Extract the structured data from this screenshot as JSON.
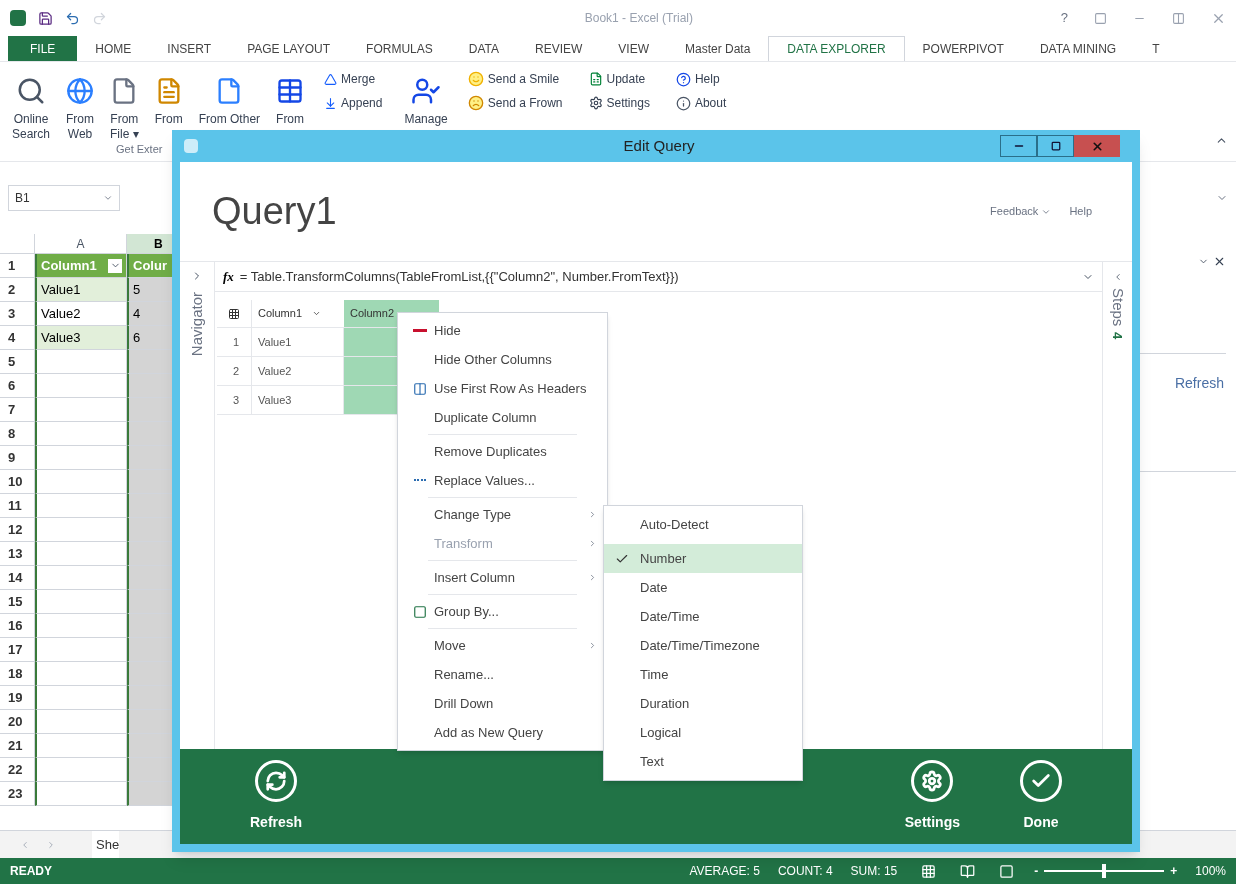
{
  "excel": {
    "title": "Book1 - Excel (Trial)",
    "help": "?",
    "tabs": [
      {
        "label": "FILE",
        "kind": "file",
        "selected": false
      },
      {
        "label": "HOME",
        "kind": "tab",
        "selected": false
      },
      {
        "label": "INSERT",
        "kind": "tab",
        "selected": false
      },
      {
        "label": "PAGE LAYOUT",
        "kind": "tab",
        "selected": false
      },
      {
        "label": "FORMULAS",
        "kind": "tab",
        "selected": false
      },
      {
        "label": "DATA",
        "kind": "tab",
        "selected": false
      },
      {
        "label": "REVIEW",
        "kind": "tab",
        "selected": false
      },
      {
        "label": "VIEW",
        "kind": "tab",
        "selected": false
      },
      {
        "label": "Master Data",
        "kind": "tab",
        "selected": false
      },
      {
        "label": "DATA EXPLORER",
        "kind": "tab",
        "selected": true
      },
      {
        "label": "POWERPIVOT",
        "kind": "tab",
        "selected": false
      },
      {
        "label": "DATA MINING",
        "kind": "tab",
        "selected": false
      },
      {
        "label": "T",
        "kind": "tab",
        "selected": false
      }
    ],
    "ribbon": [
      {
        "kind": "large",
        "lines": [
          "Online",
          "Search"
        ]
      },
      {
        "kind": "large",
        "lines": [
          "From",
          "Web"
        ]
      },
      {
        "kind": "large",
        "lines": [
          "From",
          "File ▾"
        ]
      },
      {
        "kind": "large",
        "lines": [
          "From"
        ]
      },
      {
        "kind": "large",
        "lines": [
          "From Other"
        ]
      },
      {
        "kind": "large",
        "lines": [
          "From"
        ]
      },
      {
        "kind": "stack",
        "lines": [
          "Merge",
          "Append"
        ]
      },
      {
        "kind": "large",
        "lines": [
          "Manage"
        ]
      },
      {
        "kind": "stack",
        "lines": [
          "Send a Smile",
          "Send a Frown"
        ]
      },
      {
        "kind": "stack",
        "lines": [
          "Update",
          "Settings"
        ]
      },
      {
        "kind": "stack",
        "lines": [
          "Help",
          "About"
        ]
      }
    ],
    "group_label": "Get Exter",
    "name_box": "B1",
    "columns": [
      {
        "label": "A",
        "selected": false
      },
      {
        "label": "B",
        "selected": true
      }
    ],
    "rows": [
      {
        "number": "1",
        "kind": "header",
        "cells": [
          "Column1",
          "Colur"
        ]
      },
      {
        "number": "2",
        "kind": "band",
        "cells": [
          "Value1",
          "5"
        ]
      },
      {
        "number": "3",
        "kind": "plain",
        "cells": [
          "Value2",
          "4"
        ]
      },
      {
        "number": "4",
        "kind": "band",
        "cells": [
          "Value3",
          "6"
        ]
      },
      {
        "number": "5",
        "kind": "empty"
      },
      {
        "number": "6",
        "kind": "empty"
      },
      {
        "number": "7",
        "kind": "empty"
      },
      {
        "number": "8",
        "kind": "empty"
      },
      {
        "number": "9",
        "kind": "empty"
      },
      {
        "number": "10",
        "kind": "empty"
      },
      {
        "number": "11",
        "kind": "empty"
      },
      {
        "number": "12",
        "kind": "empty"
      },
      {
        "number": "13",
        "kind": "empty"
      },
      {
        "number": "14",
        "kind": "empty"
      },
      {
        "number": "15",
        "kind": "empty"
      },
      {
        "number": "16",
        "kind": "empty"
      },
      {
        "number": "17",
        "kind": "empty"
      },
      {
        "number": "18",
        "kind": "empty"
      },
      {
        "number": "19",
        "kind": "empty"
      },
      {
        "number": "20",
        "kind": "empty"
      },
      {
        "number": "21",
        "kind": "empty"
      },
      {
        "number": "22",
        "kind": "empty"
      },
      {
        "number": "23",
        "kind": "empty"
      }
    ],
    "sheet_tab": "She",
    "side_pane": {
      "link": "Refresh"
    },
    "status": {
      "ready": "READY",
      "stats": [
        "AVERAGE: 5",
        "COUNT: 4",
        "SUM: 15"
      ],
      "zoom_out": "-",
      "zoom_in": "+",
      "zoom": "100%",
      "level": 0.5
    }
  },
  "dialog": {
    "title": "Edit Query",
    "query_name": "Query1",
    "header_links": [
      {
        "label": "Feedback",
        "dropdown": true
      },
      {
        "label": "Help",
        "dropdown": false
      }
    ],
    "navigator": "Navigator",
    "fx_label": "fx",
    "formula": "= Table.TransformColumns(TableFromList,{{\"Column2\", Number.FromText}})",
    "steps": {
      "label": "Steps",
      "count": "4"
    },
    "table": {
      "columns": [
        {
          "label": "Column1",
          "selected": false
        },
        {
          "label": "Column2",
          "selected": true
        }
      ],
      "rows": [
        {
          "number": "1",
          "cells": [
            "Value1"
          ]
        },
        {
          "number": "2",
          "cells": [
            "Value2"
          ]
        },
        {
          "number": "3",
          "cells": [
            "Value3"
          ]
        }
      ]
    },
    "buttons": [
      {
        "label": "Refresh"
      },
      {
        "label": "Settings"
      },
      {
        "label": "Done"
      }
    ],
    "context_menu": [
      [
        {
          "label": "Hide",
          "disabled": false,
          "submenu": false
        },
        {
          "label": "Hide Other Columns",
          "disabled": false,
          "submenu": false
        },
        {
          "label": "Use First Row As Headers",
          "disabled": false,
          "submenu": false
        },
        {
          "label": "Duplicate Column",
          "disabled": false,
          "submenu": false
        }
      ],
      [
        {
          "label": "Remove Duplicates",
          "disabled": false,
          "submenu": false
        },
        {
          "label": "Replace Values...",
          "disabled": false,
          "submenu": false
        }
      ],
      [
        {
          "label": "Change Type",
          "disabled": false,
          "submenu": true
        },
        {
          "label": "Transform",
          "disabled": true,
          "submenu": true
        }
      ],
      [
        {
          "label": "Insert Column",
          "disabled": false,
          "submenu": true
        }
      ],
      [
        {
          "label": "Group By...",
          "disabled": false,
          "submenu": false
        }
      ],
      [
        {
          "label": "Move",
          "disabled": false,
          "submenu": true
        },
        {
          "label": "Rename...",
          "disabled": false,
          "submenu": false
        },
        {
          "label": "Drill Down",
          "disabled": false,
          "submenu": false
        },
        {
          "label": "Add as New Query",
          "disabled": false,
          "submenu": false
        }
      ]
    ],
    "type_menu": [
      [
        {
          "label": "Auto-Detect",
          "selected": false
        }
      ],
      [
        {
          "label": "Number",
          "selected": true
        },
        {
          "label": "Date",
          "selected": false
        },
        {
          "label": "Date/Time",
          "selected": false
        },
        {
          "label": "Date/Time/Timezone",
          "selected": false
        },
        {
          "label": "Time",
          "selected": false
        },
        {
          "label": "Duration",
          "selected": false
        },
        {
          "label": "Logical",
          "selected": false
        },
        {
          "label": "Text",
          "selected": false
        }
      ]
    ]
  }
}
